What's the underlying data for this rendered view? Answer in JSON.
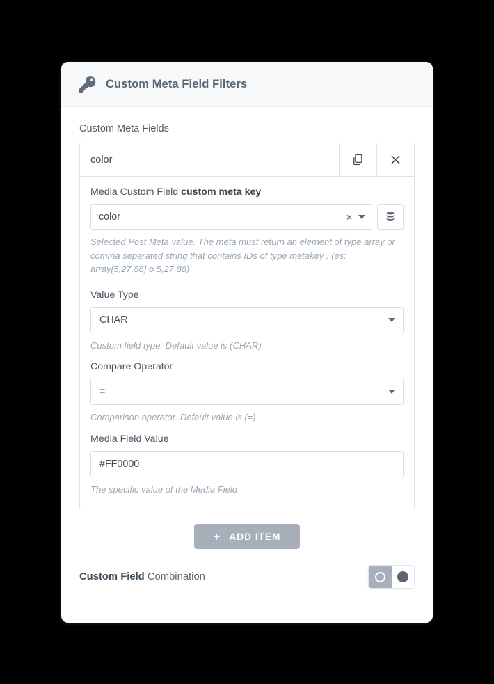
{
  "card": {
    "title": "Custom Meta Field Filters",
    "title_icon": "key-icon",
    "section_label": "Custom Meta Fields"
  },
  "item": {
    "header_title": "color",
    "copy_icon": "copy-icon",
    "close_icon": "close-icon",
    "meta_key": {
      "label_normal": "Media Custom Field ",
      "label_bold": "custom meta key",
      "value": "color",
      "clear_glyph": "×",
      "db_icon": "database-icon",
      "help": "Selected Post Meta value. The meta must return an element of type array or comma separated string that contains IDs of type metakey . (es: array[5,27,88] o 5,27,88)"
    },
    "value_type": {
      "label": "Value Type",
      "value": "CHAR",
      "help": "Custom field type. Default value is (CHAR)"
    },
    "compare_operator": {
      "label": "Compare Operator",
      "value": "=",
      "help": "Comparison operator. Default value is (=)"
    },
    "media_field_value": {
      "label": "Media Field Value",
      "value": "#FF0000",
      "help": "The specific value of the Media Field"
    }
  },
  "add_button": {
    "plus": "+",
    "label": "ADD ITEM"
  },
  "footer": {
    "label_bold": "Custom Field",
    "label_normal": " Combination",
    "toggle_state": "off"
  },
  "colors": {
    "page_background": "#000000",
    "card_background": "#ffffff",
    "header_background": "#f7f8f9",
    "title_text": "#596673",
    "help_text": "#9aa7b4",
    "border": "#dfe3e8",
    "button_gray": "#a7b0ba",
    "toggle_dot": "#5c6773"
  }
}
